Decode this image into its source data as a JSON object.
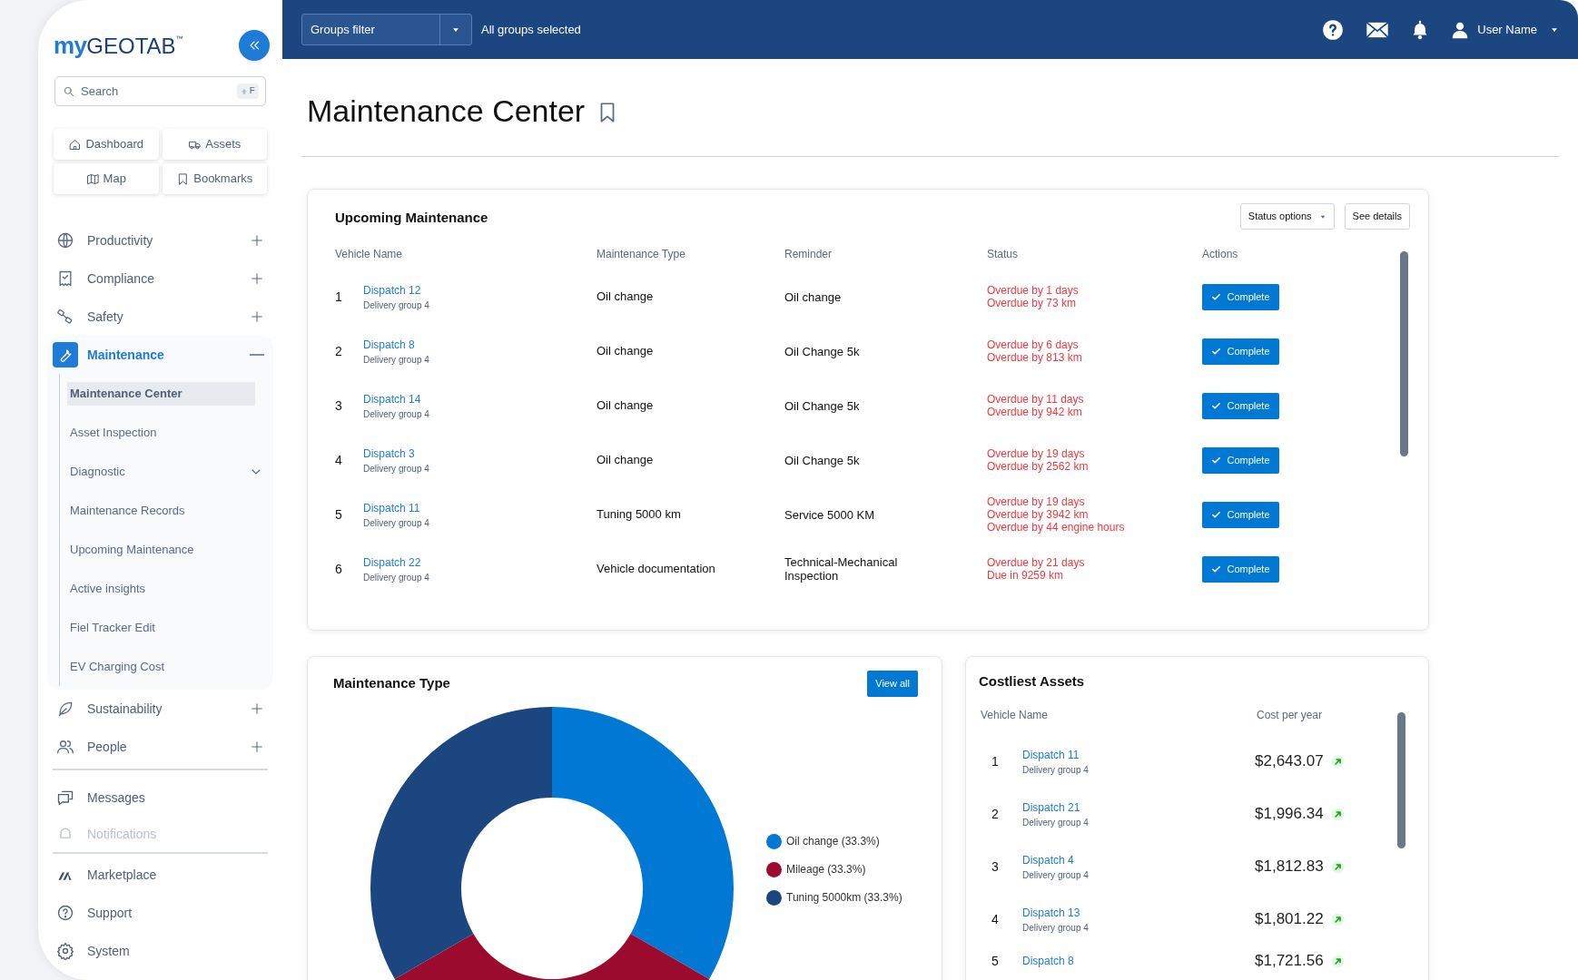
{
  "sidebar": {
    "logo": {
      "prefix": "my",
      "brand": "GEOTAB",
      "mark": "™"
    },
    "search": {
      "placeholder": "Search",
      "shortcut": "F"
    },
    "quick_links": [
      {
        "label": "Dashboard"
      },
      {
        "label": "Assets"
      },
      {
        "label": "Map"
      },
      {
        "label": "Bookmarks"
      }
    ],
    "nav": [
      {
        "label": "Productivity",
        "expanded": false,
        "selected": false
      },
      {
        "label": "Compliance",
        "expanded": false,
        "selected": false
      },
      {
        "label": "Safety",
        "expanded": false,
        "selected": false
      },
      {
        "label": "Maintenance",
        "expanded": true,
        "selected": true,
        "children": [
          {
            "label": "Maintenance Center",
            "selected": true,
            "expandable": false
          },
          {
            "label": "Asset Inspection",
            "selected": false,
            "expandable": false
          },
          {
            "label": "Diagnostic",
            "selected": false,
            "expandable": true
          },
          {
            "label": "Maintenance Records",
            "selected": false,
            "expandable": false
          },
          {
            "label": "Upcoming Maintenance",
            "selected": false,
            "expandable": false
          },
          {
            "label": "Active insights",
            "selected": false,
            "expandable": false
          },
          {
            "label": "Fiel Tracker Edit",
            "selected": false,
            "expandable": false
          },
          {
            "label": "EV Charging Cost",
            "selected": false,
            "expandable": false
          }
        ]
      },
      {
        "label": "Sustainability",
        "expanded": false,
        "selected": false
      },
      {
        "label": "People",
        "expanded": false,
        "selected": false
      }
    ],
    "utility_items": [
      {
        "label": "Messages"
      },
      {
        "label": "Notifications"
      }
    ],
    "bottom_items": [
      {
        "label": "Marketplace"
      },
      {
        "label": "Support"
      },
      {
        "label": "System"
      }
    ]
  },
  "top_bar": {
    "groups_filter": {
      "label": "Groups filter",
      "summary": "All groups selected"
    },
    "user": {
      "name": "User Name"
    }
  },
  "page": {
    "title": "Maintenance Center"
  },
  "upcoming_maintenance": {
    "title": "Upcoming Maintenance",
    "buttons": [
      "Status options",
      "See details"
    ],
    "columns": [
      "Vehicle Name",
      "Maintenance Type",
      "Reminder",
      "Status",
      "Actions"
    ],
    "rows": [
      {
        "index": "1",
        "vehicle": "Dispatch 12",
        "group": "Delivery group 4",
        "type": "Oil change",
        "reminder": "Oil change",
        "status": [
          "Overdue by 1 days",
          "Overdue by 73 km"
        ],
        "action": "Complete"
      },
      {
        "index": "2",
        "vehicle": "Dispatch 8",
        "group": "Delivery group 4",
        "type": "Oil change",
        "reminder": "Oil Change 5k",
        "status": [
          "Overdue by 6 days",
          "Overdue by 813 km"
        ],
        "action": "Complete"
      },
      {
        "index": "3",
        "vehicle": "Dispatch 14",
        "group": "Delivery group 4",
        "type": "Oil change",
        "reminder": "Oil Change 5k",
        "status": [
          "Overdue by 11 days",
          "Overdue by 942 km"
        ],
        "action": "Complete"
      },
      {
        "index": "4",
        "vehicle": "Dispatch 3",
        "group": "Delivery group 4",
        "type": "Oil change",
        "reminder": "Oil Change 5k",
        "status": [
          "Overdue by 19 days",
          "Overdue by 2562 km"
        ],
        "action": "Complete"
      },
      {
        "index": "5",
        "vehicle": "Dispatch 11",
        "group": "Delivery group 4",
        "type": "Tuning 5000 km",
        "reminder": "Service 5000 KM",
        "status": [
          "Overdue by 19 days",
          "Overdue by 3942 km",
          "Overdue by 44 engine hours"
        ],
        "action": "Complete"
      },
      {
        "index": "6",
        "vehicle": "Dispatch 22",
        "group": "Delivery group 4",
        "type": "Vehicle documentation",
        "reminder": "Technical-Mechanical Inspection",
        "status": [
          "Overdue by 21 days",
          "Due in 9259 km"
        ],
        "action": "Complete"
      }
    ]
  },
  "maintenance_type": {
    "title": "Maintenance Type",
    "button": "View all",
    "chart_data": {
      "type": "donut",
      "categories": [
        "Oil change (33.3%)",
        "Mileage (33.3%)",
        "Tuning 5000km (33.3%)"
      ],
      "values": [
        33.3,
        33.3,
        33.3
      ]
    },
    "legend": [
      {
        "color": "#0078d4"
      },
      {
        "color": "#9b0b2e"
      },
      {
        "color": "#1c4680"
      }
    ]
  },
  "costliest_assets": {
    "title": "Costliest Assets",
    "columns": [
      "Vehicle Name",
      "Cost per year"
    ],
    "rows": [
      {
        "index": "1",
        "vehicle": "Dispatch 11",
        "group": "Delivery group 4",
        "cost": "$2,643.07"
      },
      {
        "index": "2",
        "vehicle": "Dispatch 21",
        "group": "Delivery group 4",
        "cost": "$1,996.34"
      },
      {
        "index": "3",
        "vehicle": "Dispatch 4",
        "group": "Delivery group 4",
        "cost": "$1,812.83"
      },
      {
        "index": "4",
        "vehicle": "Dispatch 13",
        "group": "Delivery group 4",
        "cost": "$1,801.22"
      },
      {
        "index": "5",
        "vehicle": "Dispatch 8",
        "cost": "$1,721.56"
      }
    ]
  }
}
